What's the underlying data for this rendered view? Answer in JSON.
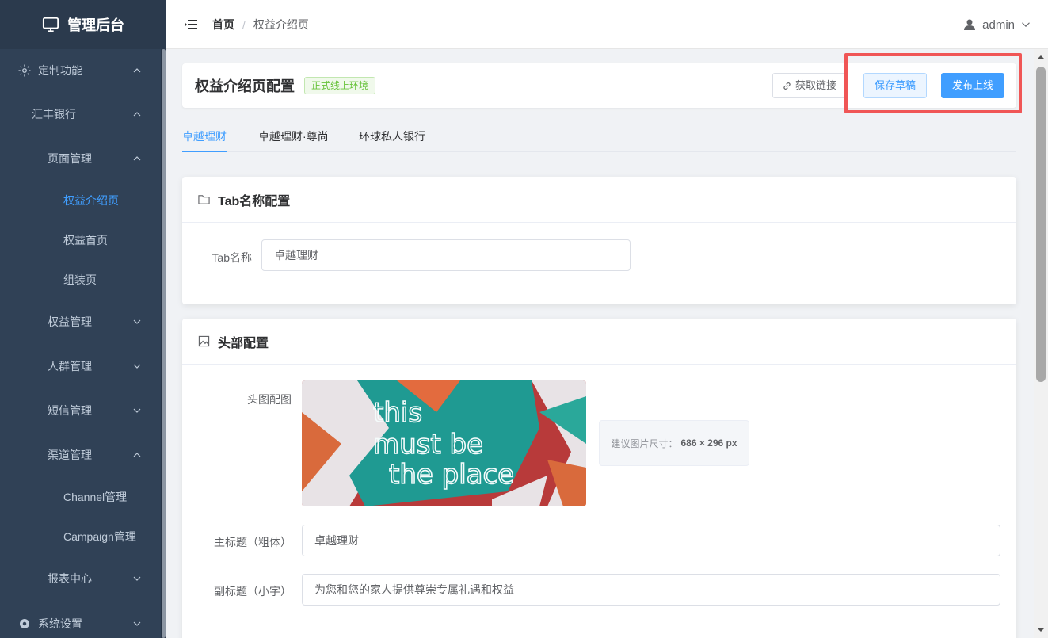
{
  "app": {
    "logo_text": "管理后台"
  },
  "sidebar": {
    "items": [
      {
        "label": "定制功能"
      },
      {
        "label": "汇丰银行"
      },
      {
        "label": "页面管理"
      },
      {
        "label": "权益介绍页"
      },
      {
        "label": "权益首页"
      },
      {
        "label": "组装页"
      },
      {
        "label": "权益管理"
      },
      {
        "label": "人群管理"
      },
      {
        "label": "短信管理"
      },
      {
        "label": "渠道管理"
      },
      {
        "label": "Channel管理"
      },
      {
        "label": "Campaign管理"
      },
      {
        "label": "报表中心"
      },
      {
        "label": "系统设置"
      }
    ]
  },
  "topbar": {
    "breadcrumb": {
      "home": "首页",
      "separator": "/",
      "current": "权益介绍页"
    },
    "user": "admin"
  },
  "page": {
    "title": "权益介绍页配置",
    "env_tag": "正式线上环境",
    "get_link": "获取链接",
    "save_draft": "保存草稿",
    "publish": "发布上线"
  },
  "tabs": [
    {
      "label": "卓越理财"
    },
    {
      "label": "卓越理财·尊尚"
    },
    {
      "label": "环球私人银行"
    }
  ],
  "tab_config": {
    "title": "Tab名称配置",
    "name_label": "Tab名称",
    "name_value": "卓越理财"
  },
  "header_config": {
    "title": "头部配置",
    "image_label": "头图配图",
    "image_text": "this must be the place",
    "size_hint_prefix": "建议图片尺寸：",
    "size_hint_value": "686 × 296 px",
    "main_title_label": "主标题（粗体）",
    "main_title_value": "卓越理财",
    "subtitle_label": "副标题（小字）",
    "subtitle_value": "为您和您的家人提供尊崇专属礼遇和权益"
  },
  "colors": {
    "sidebar": "#304156",
    "accent": "#409eff",
    "success": "#67c23a",
    "highlight": "#f05656"
  }
}
